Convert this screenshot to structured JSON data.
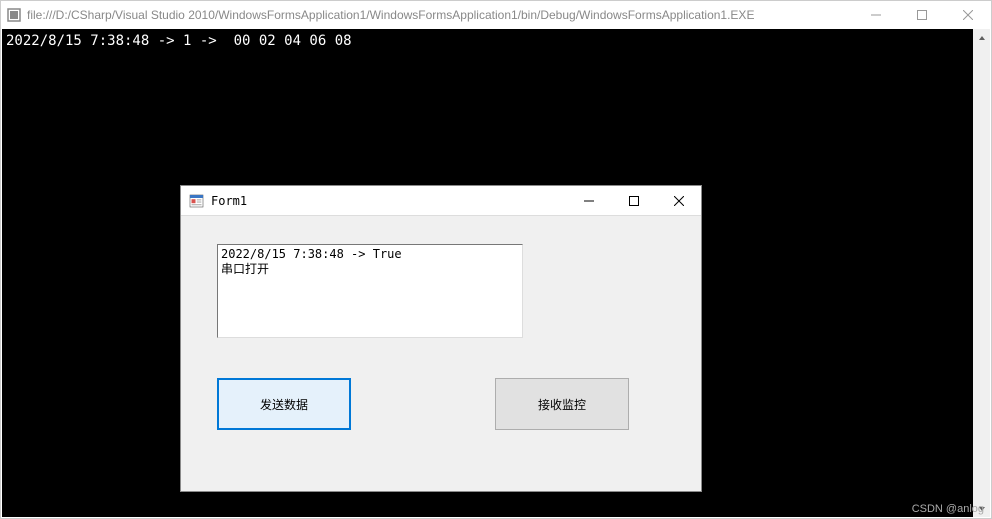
{
  "outer_window": {
    "title": "file:///D:/CSharp/Visual Studio 2010/WindowsFormsApplication1/WindowsFormsApplication1/bin/Debug/WindowsFormsApplication1.EXE"
  },
  "console": {
    "line1": "2022/8/15 7:38:48 -> 1 ->  00 02 04 06 08"
  },
  "form": {
    "title": "Form1",
    "textbox_content": "2022/8/15 7:38:48 -> True\n串口打开",
    "buttons": {
      "send_label": "发送数据",
      "recv_label": "接收监控"
    }
  },
  "watermark": "CSDN @anlog"
}
